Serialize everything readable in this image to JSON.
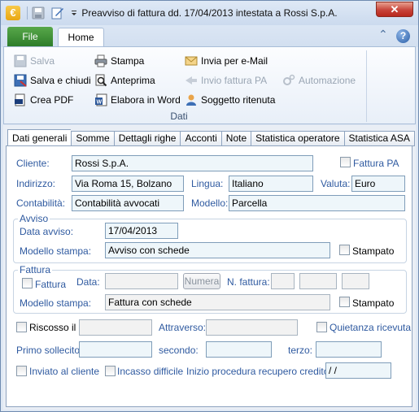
{
  "window": {
    "title": "Preavviso di fattura dd. 17/04/2013 intestata a Rossi S.p.A.",
    "app_icon_glyph": "€",
    "close_glyph": "✕"
  },
  "ribbon_tabs": {
    "file": "File",
    "home": "Home",
    "collapse_glyph": "⌃",
    "help_glyph": "?"
  },
  "ribbon": {
    "salva": "Salva",
    "salva_chiudi": "Salva e chiudi",
    "crea_pdf": "Crea PDF",
    "stampa": "Stampa",
    "anteprima": "Anteprima",
    "elabora_word": "Elabora in Word",
    "invia_email": "Invia per e-Mail",
    "invio_fattura_pa": "Invio fattura PA",
    "soggetto_ritenuta": "Soggetto ritenuta",
    "automazione": "Automazione",
    "group_label": "Dati"
  },
  "tabs": [
    "Dati generali",
    "Somme",
    "Dettagli righe",
    "Acconti",
    "Note",
    "Statistica operatore",
    "Statistica ASA"
  ],
  "form": {
    "cliente_label": "Cliente:",
    "cliente_value": "Rossi S.p.A.",
    "fattura_pa_label": "Fattura PA",
    "indirizzo_label": "Indirizzo:",
    "indirizzo_value": "Via Roma 15, Bolzano",
    "lingua_label": "Lingua:",
    "lingua_value": "Italiano",
    "valuta_label": "Valuta:",
    "valuta_value": "Euro",
    "contabilita_label": "Contabilità:",
    "contabilita_value": "Contabilità avvocati",
    "modello_label": "Modello:",
    "modello_value": "Parcella",
    "avviso_title": "Avviso",
    "data_avviso_label": "Data avviso:",
    "data_avviso_value": "17/04/2013",
    "modello_stampa_label": "Modello stampa:",
    "modello_stampa_value": "Avviso con schede",
    "stampato_label": "Stampato",
    "fattura_title": "Fattura",
    "fattura_chk_label": "Fattura",
    "data_label": "Data:",
    "numera_button": "Numera",
    "n_fattura_label": "N. fattura:",
    "fattura_modello_stampa_label": "Modello stampa:",
    "fattura_modello_stampa_value": "Fattura con schede",
    "fattura_stampato_label": "Stampato",
    "riscosso_label": "Riscosso il",
    "attraverso_label": "Attraverso:",
    "quietanza_label": "Quietanza ricevuta",
    "primo_sollecito_label": "Primo sollecito:",
    "secondo_label": "secondo:",
    "terzo_label": "terzo:",
    "inviato_label": "Inviato al cliente",
    "incasso_label": "Incasso difficile",
    "inizio_procedura_label": "Inizio procedura recupero credito:",
    "inizio_procedura_value": " / /"
  }
}
